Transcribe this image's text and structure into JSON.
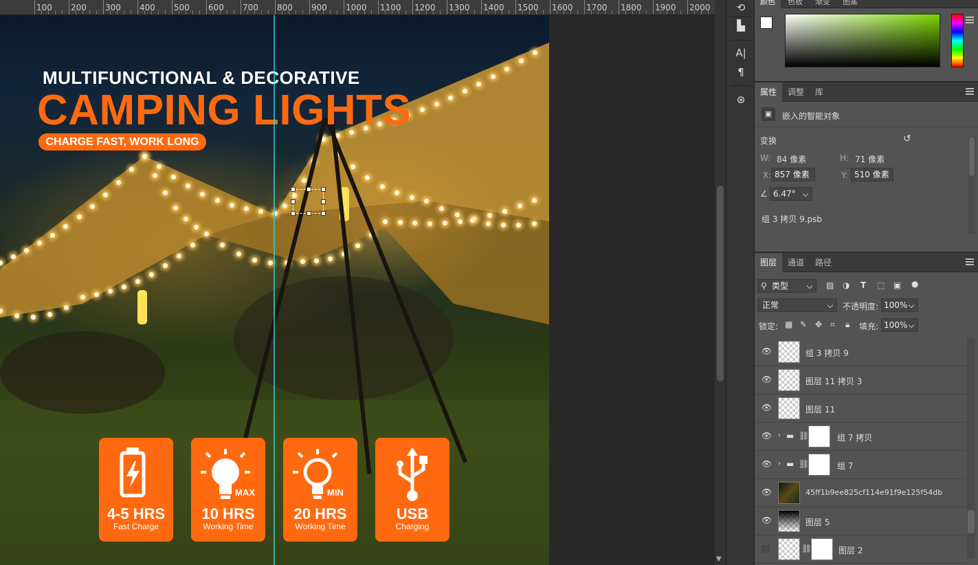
{
  "ruler": {
    "labels": [
      "100",
      "200",
      "300",
      "400",
      "500",
      "600",
      "700",
      "800",
      "900",
      "1000",
      "1100",
      "1200",
      "1300",
      "1400",
      "1500",
      "1600",
      "1700",
      "1800",
      "1900",
      "2000"
    ]
  },
  "artwork": {
    "headline_top": "MULTIFUNCTIONAL & DECORATIVE",
    "headline_main": "CAMPING LIGHTS",
    "tagline": "CHARGE FAST, WORK LONG",
    "features": [
      {
        "value": "4-5 HRS",
        "caption": "Fast Charge",
        "icon": "battery-charge-icon"
      },
      {
        "value": "10 HRS",
        "caption": "Working Time",
        "icon": "bulb-max-icon",
        "tag": "MAX"
      },
      {
        "value": "20 HRS",
        "caption": "Working Time",
        "icon": "bulb-min-icon",
        "tag": "MIN"
      },
      {
        "value": "USB",
        "caption": "Charging",
        "icon": "usb-icon"
      }
    ],
    "accent": "#ff6a10"
  },
  "color_panel": {
    "tabs": [
      "颜色",
      "色板",
      "渐变",
      "图案"
    ]
  },
  "properties": {
    "tabs": [
      "属性",
      "调整",
      "库"
    ],
    "type": "嵌入的智能对象",
    "section": "变换",
    "w_label": "W:",
    "w_value": "84 像素",
    "h_label": "H:",
    "h_value": "71 像素",
    "x_label": "X:",
    "x_value": "857 像素",
    "y_label": "Y:",
    "y_value": "510 像素",
    "angle_value": "6.47°",
    "file": "组 3 拷贝 9.psb"
  },
  "layers": {
    "tabs": [
      "图层",
      "通道",
      "路径"
    ],
    "filter_kind": "类型",
    "blend_mode": "正常",
    "opacity_label": "不透明度:",
    "opacity_value": "100%",
    "lock_label": "锁定:",
    "fill_label": "填充:",
    "fill_value": "100%",
    "items": [
      {
        "name": "组 3 拷贝 9"
      },
      {
        "name": "图层 11 拷贝 3"
      },
      {
        "name": "图层 11"
      },
      {
        "name": "组 7 拷贝"
      },
      {
        "name": "组 7"
      },
      {
        "name": "45ff1b9ee825cf114e91f9e125f54db"
      },
      {
        "name": "图层 5"
      },
      {
        "name": "图层 2"
      }
    ]
  }
}
